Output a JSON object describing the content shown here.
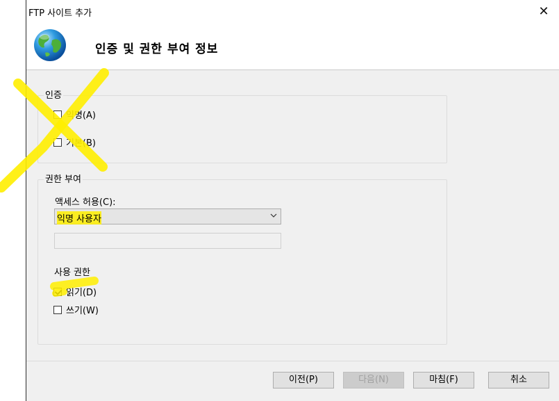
{
  "window": {
    "title": "FTP 사이트 추가",
    "close_glyph": "✕"
  },
  "header": {
    "title": "인증 및 권한 부여 정보",
    "icon": "globe-icon"
  },
  "authentication": {
    "group_label": "인증",
    "anonymous": {
      "label": "익명(A)",
      "checked": false
    },
    "basic": {
      "label": "기본(B)",
      "checked": false
    }
  },
  "authorization": {
    "group_label": "권한 부여",
    "access_label": "액세스 허용(C):",
    "access_value": "익명 사용자",
    "permissions_label": "사용 권한",
    "read": {
      "label": "읽기(D)",
      "checked": true
    },
    "write": {
      "label": "쓰기(W)",
      "checked": false
    }
  },
  "buttons": {
    "previous": "이전(P)",
    "next": "다음(N)",
    "finish": "마침(F)",
    "cancel": "취소"
  },
  "annotation_color": "#ffee00"
}
